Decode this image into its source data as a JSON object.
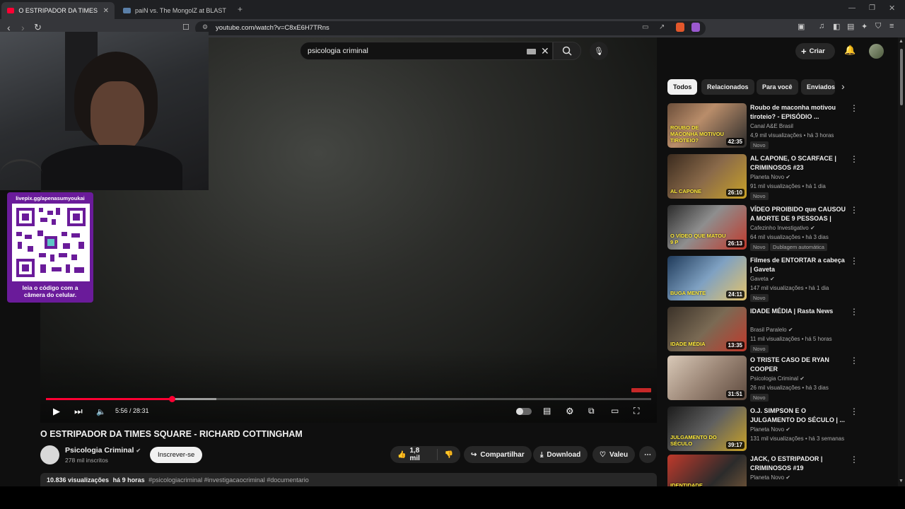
{
  "browser": {
    "tabs": [
      {
        "title": "O ESTRIPADOR DA TIMES SQUAR",
        "active": true
      },
      {
        "title": "paiN vs. The MongolZ at BLAST Boun",
        "active": false
      }
    ],
    "url": "youtube.com/watch?v=C8xE6H7TRns",
    "new_tab_icon": "+"
  },
  "header": {
    "search_value": "psicologia criminal",
    "create_label": "Criar"
  },
  "overlay": {
    "livepix_link": "livepix.gg/apenasumyoukai",
    "qr_caption": "leia o código com a câmera do celular."
  },
  "player": {
    "time": "5:56 / 28:31",
    "progress_fraction": 0.208,
    "buffer_fraction": 0.282
  },
  "video": {
    "title": "O ESTRIPADOR DA TIMES SQUARE - RICHARD COTTINGHAM",
    "channel": "Psicologia Criminal",
    "subscribers": "278 mil inscritos",
    "subscribe_label": "Inscrever-se",
    "likes": "1,8 mil",
    "share_label": "Compartilhar",
    "download_label": "Download",
    "thanks_label": "Valeu",
    "views": "10.836 visualizações",
    "age": "há 9 horas",
    "hashtags": "#psicologiacriminal #investigacaocriminal #documentario"
  },
  "chips": [
    "Todos",
    "Relacionados",
    "Para você",
    "Enviados"
  ],
  "recommendations": [
    {
      "title": "Roubo de maconha motivou tiroteio? - EPISÓDIO ...",
      "channel": "Canal A&E Brasil",
      "meta": "4,9 mil visualizações • há 3 horas",
      "badge": "Novo",
      "duration": "42:35",
      "verified": false,
      "thumb_text": "ROUBO DE MACONHA MOTIVOU TIROTEIO?"
    },
    {
      "title": "AL CAPONE, O SCARFACE | CRIMINOSOS #23",
      "channel": "Planeta Novo",
      "meta": "91 mil visualizações • há 1 dia",
      "badge": "Novo",
      "duration": "26:10",
      "verified": true,
      "thumb_text": "AL CAPONE"
    },
    {
      "title": "VÍDEO PROIBIDO que CAUSOU A MORTE DE 9 PESSOAS | Cas...",
      "channel": "Cafezinho Investigativo",
      "meta": "64 mil visualizações • há 3 dias",
      "badge": "Novo",
      "badge2": "Dublagem automática",
      "duration": "26:13",
      "verified": true,
      "thumb_text": "O VÍDEO QUE MATOU 9 P"
    },
    {
      "title": "Filmes de ENTORTAR a cabeça | Gaveta",
      "channel": "Gaveta",
      "meta": "147 mil visualizações • há 1 dia",
      "badge": "Novo",
      "duration": "24:11",
      "verified": true,
      "thumb_text": "BUGA MENTE"
    },
    {
      "title": "IDADE MÉDIA | Rasta News",
      "channel": "Brasil Paralelo",
      "meta": "11 mil visualizações • há 5 horas",
      "badge": "Novo",
      "duration": "13:35",
      "verified": true,
      "thumb_text": "IDADE MÉDIA"
    },
    {
      "title": "O TRISTE CASO DE RYAN COOPER",
      "channel": "Psicologia Criminal",
      "meta": "26 mil visualizações • há 3 dias",
      "badge": "Novo",
      "duration": "31:51",
      "verified": true,
      "thumb_text": ""
    },
    {
      "title": "O.J. SIMPSON E O JULGAMENTO DO SÉCULO | ...",
      "channel": "Planeta Novo",
      "meta": "131 mil visualizações • há 3 semanas",
      "badge": "",
      "duration": "39:17",
      "verified": true,
      "thumb_text": "JULGAMENTO DO SÉCULO"
    },
    {
      "title": "JACK, O ESTRIPADOR | CRIMINOSOS #19",
      "channel": "Planeta Novo",
      "meta": "",
      "badge": "",
      "duration": "",
      "verified": true,
      "thumb_text": "IDENTIDADE REVELADA"
    }
  ],
  "colors": {
    "accent_red": "#ff0033",
    "qr_purple": "#6a1b9a"
  }
}
